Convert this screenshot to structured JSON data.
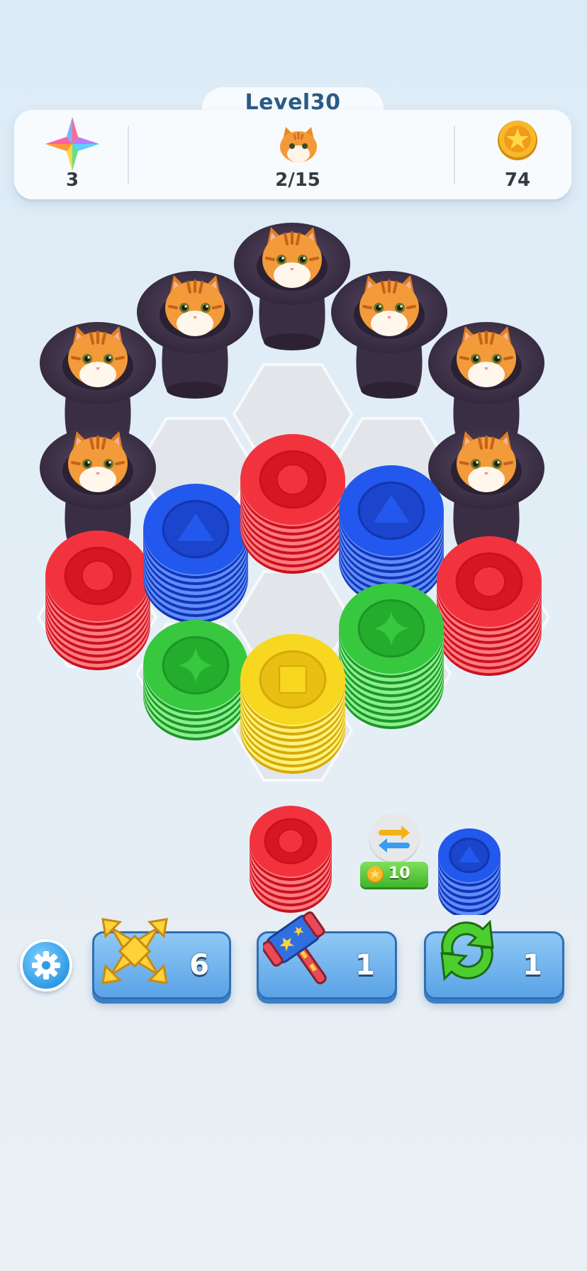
{
  "hud": {
    "level_label": "Level30",
    "stars": {
      "icon": "rainbow-star-icon",
      "value": "3"
    },
    "cats": {
      "icon": "cat-face-icon",
      "value": "2/15"
    },
    "coins": {
      "icon": "gold-coin-icon",
      "value": "74"
    }
  },
  "board": {
    "cat_hats": 7,
    "stacks": [
      {
        "color": "red",
        "symbol": "circle"
      },
      {
        "color": "blue",
        "symbol": "triangle"
      },
      {
        "color": "red",
        "symbol": "circle"
      },
      {
        "color": "blue",
        "symbol": "triangle"
      },
      {
        "color": "red",
        "symbol": "circle"
      },
      {
        "color": "green",
        "symbol": "diamond-star"
      },
      {
        "color": "green",
        "symbol": "diamond-star"
      },
      {
        "color": "yellow",
        "symbol": "square"
      }
    ]
  },
  "tray": {
    "left_stack": {
      "color": "red",
      "symbol": "circle"
    },
    "right_stack": {
      "color": "blue",
      "symbol": "triangle"
    },
    "swap": {
      "icon": "swap-arrows-icon",
      "price": "10",
      "price_icon": "coin-icon"
    }
  },
  "toolbar": {
    "settings_icon": "gear-icon",
    "boosters": [
      {
        "icon": "move-arrows-icon",
        "count": "6"
      },
      {
        "icon": "hammer-icon",
        "count": "1"
      },
      {
        "icon": "refresh-icon",
        "count": "1"
      }
    ]
  },
  "colors": {
    "red": "#e8242f",
    "blue": "#1f4fe0",
    "green": "#2fbf3a",
    "yellow": "#f5d117",
    "hat": "#3d3046"
  }
}
